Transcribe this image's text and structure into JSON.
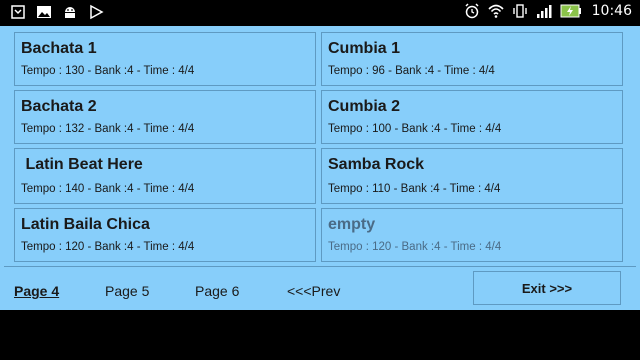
{
  "status_bar": {
    "time": "10:46",
    "left_icons": [
      "usb-debug-icon",
      "image-icon",
      "android-icon",
      "play-store-icon"
    ],
    "right_icons": [
      "alarm-icon",
      "wifi-icon",
      "vibrate-icon",
      "signal-icon",
      "battery-charging-icon"
    ]
  },
  "tiles": [
    {
      "name": "Bachata 1",
      "info": "Tempo : 130 - Bank :4 - Time : 4/4"
    },
    {
      "name": "Cumbia 1",
      "info": "Tempo : 96 - Bank :4 - Time : 4/4"
    },
    {
      "name": "Bachata 2",
      "info": "Tempo : 132 - Bank :4 - Time : 4/4"
    },
    {
      "name": "Cumbia 2",
      "info": "Tempo : 100 - Bank :4 - Time : 4/4"
    },
    {
      "name": " Latin Beat Here",
      "info": "Tempo : 140 - Bank :4 - Time : 4/4"
    },
    {
      "name": "Samba Rock",
      "info": "Tempo : 110 - Bank :4 - Time : 4/4"
    },
    {
      "name": "Latin Baila Chica",
      "info": "Tempo : 120 - Bank :4 - Time : 4/4"
    },
    {
      "name": "empty",
      "info": "Tempo : 120 - Bank :4 - Time : 4/4"
    }
  ],
  "pagination": {
    "page4": "Page 4",
    "page5": "Page 5",
    "page6": "Page 6",
    "prev": "<<<Prev",
    "active": "Page 4"
  },
  "exit_label": "Exit >>>",
  "colors": {
    "background": "#87CEFA",
    "border": "#5e9ac2",
    "text": "#1a1a1a",
    "empty_text": "#4a6b86"
  }
}
